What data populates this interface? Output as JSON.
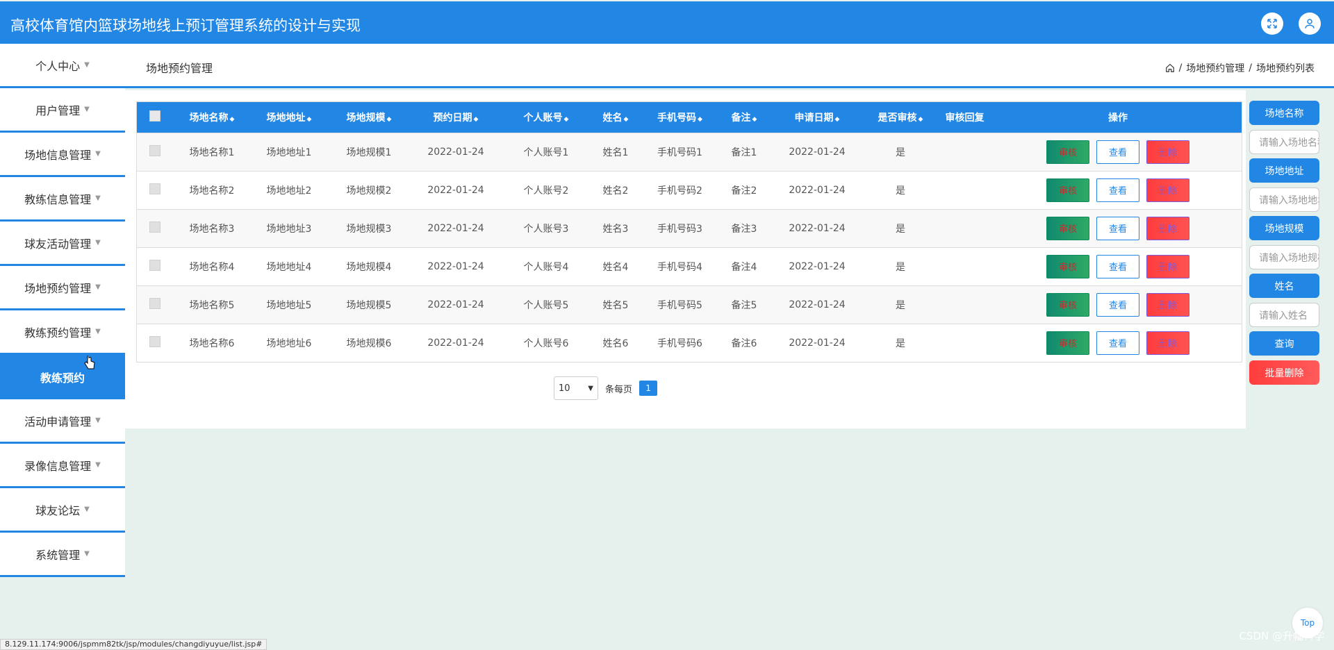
{
  "header": {
    "title": "高校体育馆内篮球场地线上预订管理系统的设计与实现"
  },
  "subheader": {
    "user_center": "个人中心",
    "page_title": "场地预约管理",
    "breadcrumb": [
      "场地预约管理",
      "场地预约列表"
    ]
  },
  "sidebar": {
    "items": [
      {
        "label": "用户管理"
      },
      {
        "label": "场地信息管理"
      },
      {
        "label": "教练信息管理"
      },
      {
        "label": "球友活动管理"
      },
      {
        "label": "场地预约管理"
      },
      {
        "label": "教练预约管理"
      },
      {
        "label": "教练预约"
      },
      {
        "label": "活动申请管理"
      },
      {
        "label": "录像信息管理"
      },
      {
        "label": "球友论坛"
      },
      {
        "label": "系统管理"
      }
    ]
  },
  "table": {
    "columns": [
      "场地名称",
      "场地地址",
      "场地规模",
      "预约日期",
      "个人账号",
      "姓名",
      "手机号码",
      "备注",
      "申请日期",
      "是否审核",
      "审核回复",
      "操作"
    ],
    "rows": [
      [
        "场地名称1",
        "场地地址1",
        "场地规模1",
        "2022-01-24",
        "个人账号1",
        "姓名1",
        "手机号码1",
        "备注1",
        "2022-01-24",
        "是",
        ""
      ],
      [
        "场地名称2",
        "场地地址2",
        "场地规模2",
        "2022-01-24",
        "个人账号2",
        "姓名2",
        "手机号码2",
        "备注2",
        "2022-01-24",
        "是",
        ""
      ],
      [
        "场地名称3",
        "场地地址3",
        "场地规模3",
        "2022-01-24",
        "个人账号3",
        "姓名3",
        "手机号码3",
        "备注3",
        "2022-01-24",
        "是",
        ""
      ],
      [
        "场地名称4",
        "场地地址4",
        "场地规模4",
        "2022-01-24",
        "个人账号4",
        "姓名4",
        "手机号码4",
        "备注4",
        "2022-01-24",
        "是",
        ""
      ],
      [
        "场地名称5",
        "场地地址5",
        "场地规模5",
        "2022-01-24",
        "个人账号5",
        "姓名5",
        "手机号码5",
        "备注5",
        "2022-01-24",
        "是",
        ""
      ],
      [
        "场地名称6",
        "场地地址6",
        "场地规模6",
        "2022-01-24",
        "个人账号6",
        "姓名6",
        "手机号码6",
        "备注6",
        "2022-01-24",
        "是",
        ""
      ]
    ],
    "actions": {
      "review": "审核",
      "view": "查看",
      "delete": "删除"
    }
  },
  "pagination": {
    "page_size": "10",
    "per_page_label": "条每页",
    "current_page": "1"
  },
  "search": {
    "field1_label": "场地名称",
    "field1_placeholder": "请输入场地名称",
    "field2_label": "场地地址",
    "field2_placeholder": "请输入场地地址",
    "field3_label": "场地规模",
    "field3_placeholder": "请输入场地规模",
    "field4_label": "姓名",
    "field4_placeholder": "请输入姓名",
    "query_label": "查询",
    "batch_delete_label": "批量删除"
  },
  "status_bar": {
    "url": "8.129.11.174:9006/jspmm82tk/jsp/modules/changdiyuyue/list.jsp#"
  },
  "back_to_top": "Top",
  "watermark": "CSDN @升幅科学",
  "colors": {
    "primary": "#2186e4",
    "review_btn": "#108a6e",
    "delete_btn": "#ff3d3d",
    "page_bg": "#e6f0ec"
  },
  "icons": {
    "fullscreen": "expand-arrows-icon",
    "user": "user-avatar-icon",
    "home": "home-icon"
  }
}
